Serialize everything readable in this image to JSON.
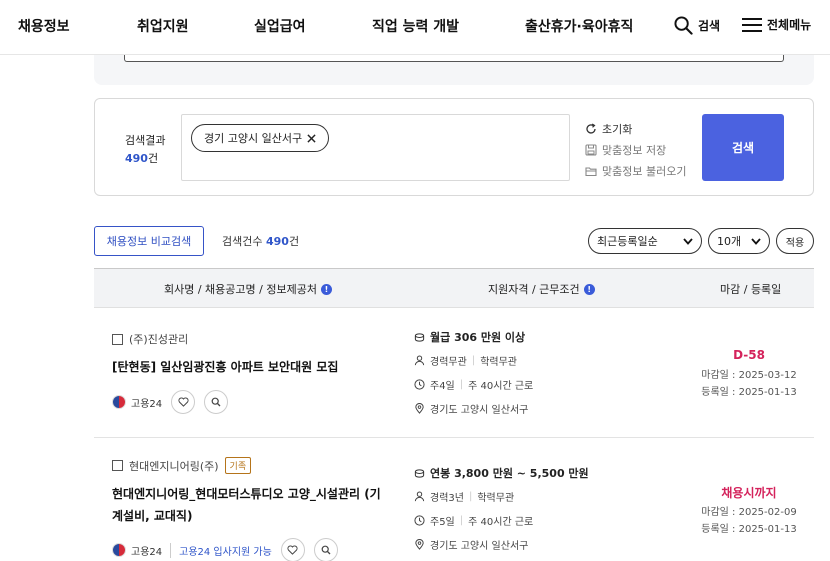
{
  "nav": {
    "items": [
      "채용정보",
      "취업지원",
      "실업급여",
      "직업 능력 개발",
      "출산휴가·육아휴직"
    ],
    "search_label": "검색",
    "menu_label": "전체메뉴"
  },
  "search_result": {
    "label": "검색결과",
    "count": "490",
    "count_unit": "건",
    "chip_label": "경기 고양시 일산서구",
    "actions": {
      "reset": "초기화",
      "save": "맞춤정보 저장",
      "load": "맞춤정보 불러오기"
    },
    "search_button": "검색"
  },
  "toolbar": {
    "compare_button": "채용정보 비교검색",
    "count_label": "검색건수",
    "count": "490",
    "count_unit": "건",
    "sort_selected": "최근등록일순",
    "page_size_selected": "10개",
    "apply_button": "적용"
  },
  "table": {
    "headers": {
      "company": "회사명 / 채용공고명 / 정보제공처",
      "qualification": "지원자격 / 근무조건",
      "deadline": "마감 / 등록일"
    },
    "rows": [
      {
        "company": "(주)진성관리",
        "title": "[탄현동] 일산임광진흥 아파트 보안대원 모집",
        "source": "고용24",
        "pay": "월급 306 만원 이상",
        "career": "경력무관",
        "education": "학력무관",
        "days": "주4일",
        "hours": "주 40시간 근로",
        "location": "경기도 고양시 일산서구",
        "deadline": "D-58",
        "close_date": "마감일 : 2025-03-12",
        "reg_date": "등록일 : 2025-01-13"
      },
      {
        "company": "현대엔지니어링(주)",
        "tag": "기족",
        "title": "현대엔지니어링_현대모터스튜디오 고양_시설관리 (기계설비, 교대직)",
        "source": "고용24",
        "source_link": "고용24 입사지원 가능",
        "pay": "연봉 3,800 만원 ~ 5,500 만원",
        "career": "경력3년",
        "education": "학력무관",
        "days": "주5일",
        "hours": "주 40시간 근로",
        "location": "경기도 고양시 일산서구",
        "deadline": "채용시까지",
        "close_date": "마감일 : 2025-02-09",
        "reg_date": "등록일 : 2025-01-13"
      }
    ]
  },
  "icons": {
    "search": "search-icon",
    "menu": "hamburger-menu-icon",
    "reset": "refresh-icon",
    "save": "save-icon",
    "load": "folder-icon",
    "close": "close-icon",
    "info": "info-icon",
    "heart": "heart-icon",
    "magnifier": "magnifier-icon",
    "money": "coin-icon",
    "person": "person-icon",
    "clock": "clock-icon",
    "pin": "location-pin-icon"
  },
  "colors": {
    "accent": "#4b62e0",
    "link": "#2f55c9",
    "deadline": "#d4225b"
  }
}
